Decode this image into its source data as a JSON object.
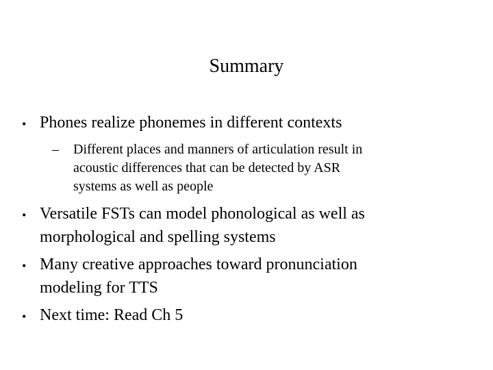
{
  "slide": {
    "title": "Summary",
    "bullets": [
      {
        "text": "Phones realize phonemes in different contexts",
        "sub": [
          "Different places and manners of articulation result in",
          "acoustic differences that can be detected by ASR",
          "systems as well as people"
        ]
      },
      {
        "lines": [
          "Versatile FSTs can model phonological as well as",
          "morphological and spelling systems"
        ]
      },
      {
        "lines": [
          "Many creative approaches toward pronunciation",
          "modeling for TTS"
        ]
      },
      {
        "lines": [
          "Next time: Read Ch 5"
        ]
      }
    ],
    "bullet_glyph": "•",
    "dash_glyph": "–"
  }
}
